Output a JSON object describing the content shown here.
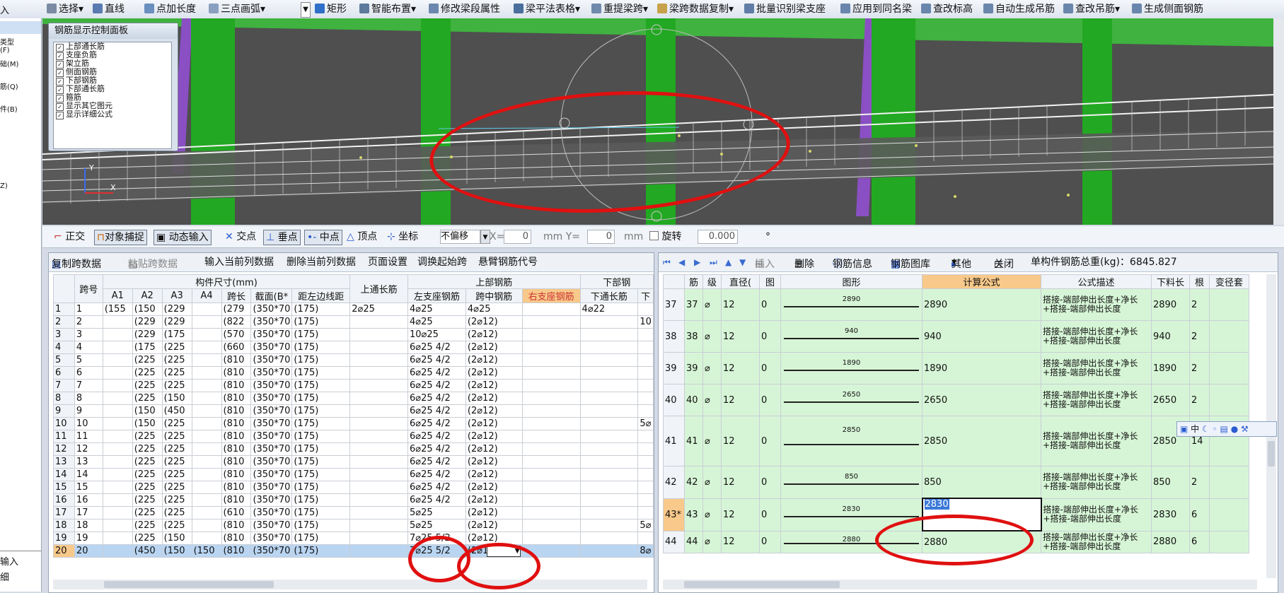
{
  "toolbar": {
    "items": [
      "选择",
      "直线",
      "点加长度",
      "三点画弧",
      "矩形",
      "智能布置",
      "修改梁段属性",
      "梁平法表格",
      "重提梁跨",
      "梁跨数据复制",
      "批量识别梁支座",
      "应用到同名梁",
      "查改标高",
      "自动生成吊筋",
      "查改吊筋",
      "生成侧面钢筋"
    ]
  },
  "left_strip": {
    "items": [
      "入",
      "类型",
      "(F)",
      "础(M)",
      "筋(Q)",
      "件(B)",
      "Z)",
      "输入",
      "细"
    ]
  },
  "rebar_panel": {
    "title": "钢筋显示控制面板",
    "items": [
      "上部通长筋",
      "支座负筋",
      "架立筋",
      "侧面钢筋",
      "下部钢筋",
      "下部通长筋",
      "箍筋",
      "显示其它图元",
      "显示详细公式"
    ]
  },
  "axis": {
    "x": "X",
    "y": "Y"
  },
  "snapbar": {
    "items": [
      "正交",
      "对象捕捉",
      "动态输入",
      "交点",
      "垂点",
      "中点",
      "顶点",
      "坐标"
    ],
    "offset_mode": "不偏移",
    "x_label": "X=",
    "x_value": "0",
    "y_label": "mm Y=",
    "y_value": "0",
    "unit": "mm",
    "rotate_label": "旋转",
    "rotate_value": "0.000",
    "degree": "°"
  },
  "left_panel": {
    "toolbar": [
      "复制跨数据",
      "粘贴跨数据",
      "输入当前列数据",
      "删除当前列数据",
      "页面设置",
      "调换起始跨",
      "悬臂钢筋代号"
    ],
    "header_row1": {
      "span_no": "跨号",
      "dims": "构件尺寸(mm)",
      "top_long": "上通长筋",
      "top_steel": "上部钢筋",
      "bottom_steel": "下部钢"
    },
    "header_row2": [
      "A1",
      "A2",
      "A3",
      "A4",
      "跨长",
      "截面(B*",
      "距左边线距",
      "左支座钢筋",
      "跨中钢筋",
      "右支座钢筋",
      "下通长筋",
      "下"
    ],
    "rows": [
      [
        "1",
        "1",
        "(155",
        "(150",
        "(229",
        "",
        "(279",
        "(350*70",
        "(175)",
        "2⌀25",
        "4⌀25",
        "4⌀25",
        "",
        "4⌀22",
        ""
      ],
      [
        "2",
        "2",
        "",
        "(229",
        "(229",
        "",
        "(822",
        "(350*70",
        "(175)",
        "",
        "4⌀25",
        "(2⌀12)",
        "",
        "",
        "10"
      ],
      [
        "3",
        "3",
        "",
        "(229",
        "(175",
        "",
        "(570",
        "(350*70",
        "(175)",
        "",
        "10⌀25",
        "(2⌀12)",
        "",
        "",
        ""
      ],
      [
        "4",
        "4",
        "",
        "(175",
        "(225",
        "",
        "(660",
        "(350*70",
        "(175)",
        "",
        "6⌀25 4/2",
        "(2⌀12)",
        "",
        "",
        ""
      ],
      [
        "5",
        "5",
        "",
        "(225",
        "(225",
        "",
        "(810",
        "(350*70",
        "(175)",
        "",
        "6⌀25 4/2",
        "(2⌀12)",
        "",
        "",
        ""
      ],
      [
        "6",
        "6",
        "",
        "(225",
        "(225",
        "",
        "(810",
        "(350*70",
        "(175)",
        "",
        "6⌀25 4/2",
        "(2⌀12)",
        "",
        "",
        ""
      ],
      [
        "7",
        "7",
        "",
        "(225",
        "(225",
        "",
        "(810",
        "(350*70",
        "(175)",
        "",
        "6⌀25 4/2",
        "(2⌀12)",
        "",
        "",
        ""
      ],
      [
        "8",
        "8",
        "",
        "(225",
        "(150",
        "",
        "(810",
        "(350*70",
        "(175)",
        "",
        "6⌀25 4/2",
        "(2⌀12)",
        "",
        "",
        ""
      ],
      [
        "9",
        "9",
        "",
        "(150",
        "(450",
        "",
        "(810",
        "(350*70",
        "(175)",
        "",
        "6⌀25 4/2",
        "(2⌀12)",
        "",
        "",
        ""
      ],
      [
        "10",
        "10",
        "",
        "(150",
        "(225",
        "",
        "(810",
        "(350*70",
        "(175)",
        "",
        "6⌀25 4/2",
        "(2⌀12)",
        "",
        "",
        "5⌀"
      ],
      [
        "11",
        "11",
        "",
        "(225",
        "(225",
        "",
        "(810",
        "(350*70",
        "(175)",
        "",
        "6⌀25 4/2",
        "(2⌀12)",
        "",
        "",
        ""
      ],
      [
        "12",
        "12",
        "",
        "(225",
        "(225",
        "",
        "(810",
        "(350*70",
        "(175)",
        "",
        "6⌀25 4/2",
        "(2⌀12)",
        "",
        "",
        ""
      ],
      [
        "13",
        "13",
        "",
        "(225",
        "(225",
        "",
        "(810",
        "(350*70",
        "(175)",
        "",
        "6⌀25 4/2",
        "(2⌀12)",
        "",
        "",
        ""
      ],
      [
        "14",
        "14",
        "",
        "(225",
        "(225",
        "",
        "(810",
        "(350*70",
        "(175)",
        "",
        "6⌀25 4/2",
        "(2⌀12)",
        "",
        "",
        ""
      ],
      [
        "15",
        "15",
        "",
        "(225",
        "(225",
        "",
        "(810",
        "(350*70",
        "(175)",
        "",
        "6⌀25 4/2",
        "(2⌀12)",
        "",
        "",
        ""
      ],
      [
        "16",
        "16",
        "",
        "(225",
        "(225",
        "",
        "(810",
        "(350*70",
        "(175)",
        "",
        "6⌀25 4/2",
        "(2⌀12)",
        "",
        "",
        ""
      ],
      [
        "17",
        "17",
        "",
        "(225",
        "(225",
        "",
        "(610",
        "(350*70",
        "(175)",
        "",
        "5⌀25",
        "(2⌀12)",
        "",
        "",
        ""
      ],
      [
        "18",
        "18",
        "",
        "(225",
        "(225",
        "",
        "(810",
        "(350*70",
        "(175)",
        "",
        "5⌀25",
        "(2⌀12)",
        "",
        "",
        "5⌀"
      ],
      [
        "19",
        "19",
        "",
        "(225",
        "(150",
        "",
        "(810",
        "(350*70",
        "(175)",
        "",
        "7⌀25 5/2",
        "(2⌀12)",
        "",
        "",
        ""
      ],
      [
        "20",
        "20",
        "",
        "(450",
        "(150",
        "(150",
        "(810",
        "(350*70",
        "(175)",
        "",
        "7⌀25 5/2",
        "(2⌀12)",
        "",
        "",
        "8⌀"
      ]
    ]
  },
  "right_panel": {
    "toolbar": [
      "插入",
      "删除",
      "钢筋信息",
      "钢筋图库",
      "其他",
      "关闭"
    ],
    "total_weight_label": "单构件钢筋总重(kg)：6845.827",
    "headers": [
      "",
      "筋",
      "级",
      "直径(",
      "图",
      "图形",
      "计算公式",
      "公式描述",
      "下料长",
      "根",
      "变径套"
    ],
    "rows": [
      {
        "rn": "37",
        "no": "37",
        "grade": "⌀",
        "dia": "12",
        "fig": "0",
        "shape": "2890",
        "formula": "2890",
        "desc": "搭接-端部伸出长度+净长+搭接-端部伸出长度",
        "len": "2890",
        "count": "2"
      },
      {
        "rn": "38",
        "no": "38",
        "grade": "⌀",
        "dia": "12",
        "fig": "0",
        "shape": "940",
        "formula": "940",
        "desc": "搭接-端部伸出长度+净长+搭接-端部伸出长度",
        "len": "940",
        "count": "2"
      },
      {
        "rn": "39",
        "no": "39",
        "grade": "⌀",
        "dia": "12",
        "fig": "0",
        "shape": "1890",
        "formula": "1890",
        "desc": "搭接-端部伸出长度+净长+搭接-端部伸出长度",
        "len": "1890",
        "count": "2"
      },
      {
        "rn": "40",
        "no": "40",
        "grade": "⌀",
        "dia": "12",
        "fig": "0",
        "shape": "2650",
        "formula": "2650",
        "desc": "搭接-端部伸出长度+净长+搭接-端部伸出长度",
        "len": "2650",
        "count": "2"
      },
      {
        "rn": "41",
        "no": "41",
        "grade": "⌀",
        "dia": "12",
        "fig": "0",
        "shape": "2850",
        "formula": "2850",
        "desc": "搭接-端部伸出长度+净长+搭接-端部伸出长度",
        "len": "2850",
        "count": "14"
      },
      {
        "rn": "42",
        "no": "42",
        "grade": "⌀",
        "dia": "12",
        "fig": "0",
        "shape": "850",
        "formula": "850",
        "desc": "搭接-端部伸出长度+净长+搭接-端部伸出长度",
        "len": "850",
        "count": "2"
      },
      {
        "rn": "43*",
        "no": "43",
        "grade": "⌀",
        "dia": "12",
        "fig": "0",
        "shape": "2830",
        "formula": "2830",
        "desc": "搭接-端部伸出长度+净长+搭接-端部伸出长度",
        "len": "2830",
        "count": "6"
      },
      {
        "rn": "44",
        "no": "44",
        "grade": "⌀",
        "dia": "12",
        "fig": "0",
        "shape": "2880",
        "formula": "2880",
        "desc": "搭接-端部伸出长度+净长+搭接-端部伸出长度",
        "len": "2880",
        "count": "6"
      }
    ]
  },
  "ime_bar": {
    "text": "中"
  },
  "colors": {
    "highlight": "#f8c98a",
    "green_row": "#d6f5d6",
    "annotation": "#e01010",
    "column": "#22a822",
    "purple": "#8a4fc2"
  }
}
